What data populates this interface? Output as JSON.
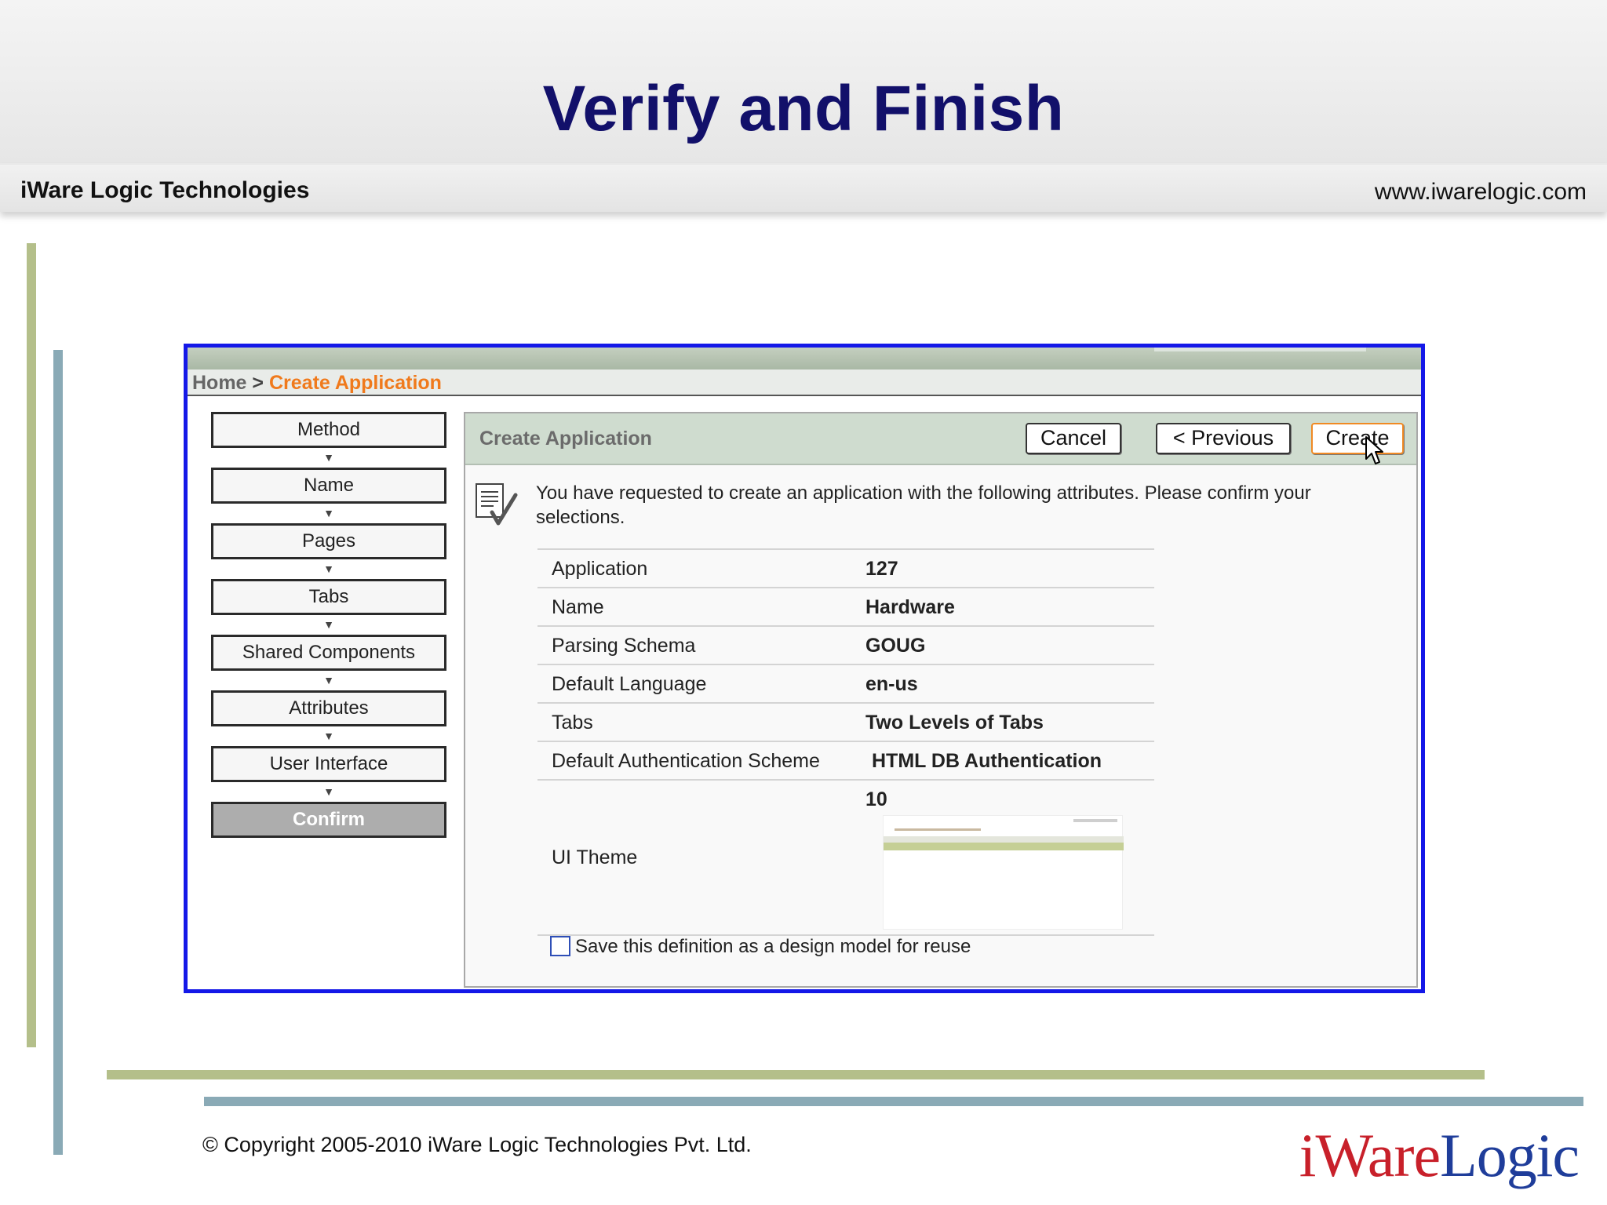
{
  "slide": {
    "title": "Verify and Finish",
    "company": "iWare Logic Technologies",
    "url": "www.iwarelogic.com",
    "copyright": "© Copyright 2005-2010 iWare Logic Technologies Pvt. Ltd.",
    "logo": {
      "part1": "i",
      "part2": "Ware",
      "part3": "Logic"
    }
  },
  "breadcrumb": {
    "home": "Home",
    "separator": ">",
    "current": "Create Application"
  },
  "steps": [
    {
      "label": "Method",
      "active": false
    },
    {
      "label": "Name",
      "active": false
    },
    {
      "label": "Pages",
      "active": false
    },
    {
      "label": "Tabs",
      "active": false
    },
    {
      "label": "Shared Components",
      "active": false
    },
    {
      "label": "Attributes",
      "active": false
    },
    {
      "label": "User Interface",
      "active": false
    },
    {
      "label": "Confirm",
      "active": true
    }
  ],
  "panel": {
    "title": "Create Application",
    "buttons": {
      "cancel": "Cancel",
      "previous": "< Previous",
      "create": "Create"
    },
    "intro": "You have requested to create an application with the following attributes. Please confirm your selections.",
    "attributes": [
      {
        "label": "Application",
        "value": "127"
      },
      {
        "label": "Name",
        "value": "Hardware"
      },
      {
        "label": "Parsing Schema",
        "value": "GOUG"
      },
      {
        "label": "Default Language",
        "value": "en-us"
      },
      {
        "label": "Tabs",
        "value": "Two Levels of Tabs"
      },
      {
        "label": "Default Authentication Scheme",
        "value": "HTML DB Authentication"
      }
    ],
    "ui_theme": {
      "label": "UI Theme",
      "value": "10"
    },
    "save_checkbox": {
      "label": "Save this definition as a design model for reuse",
      "checked": false
    }
  },
  "colors": {
    "title": "#12106a",
    "frame_border": "#1418e8",
    "breadcrumb_current": "#f07a1c",
    "accent_green": "#b4bf8a",
    "accent_blue": "#8aaab6"
  }
}
